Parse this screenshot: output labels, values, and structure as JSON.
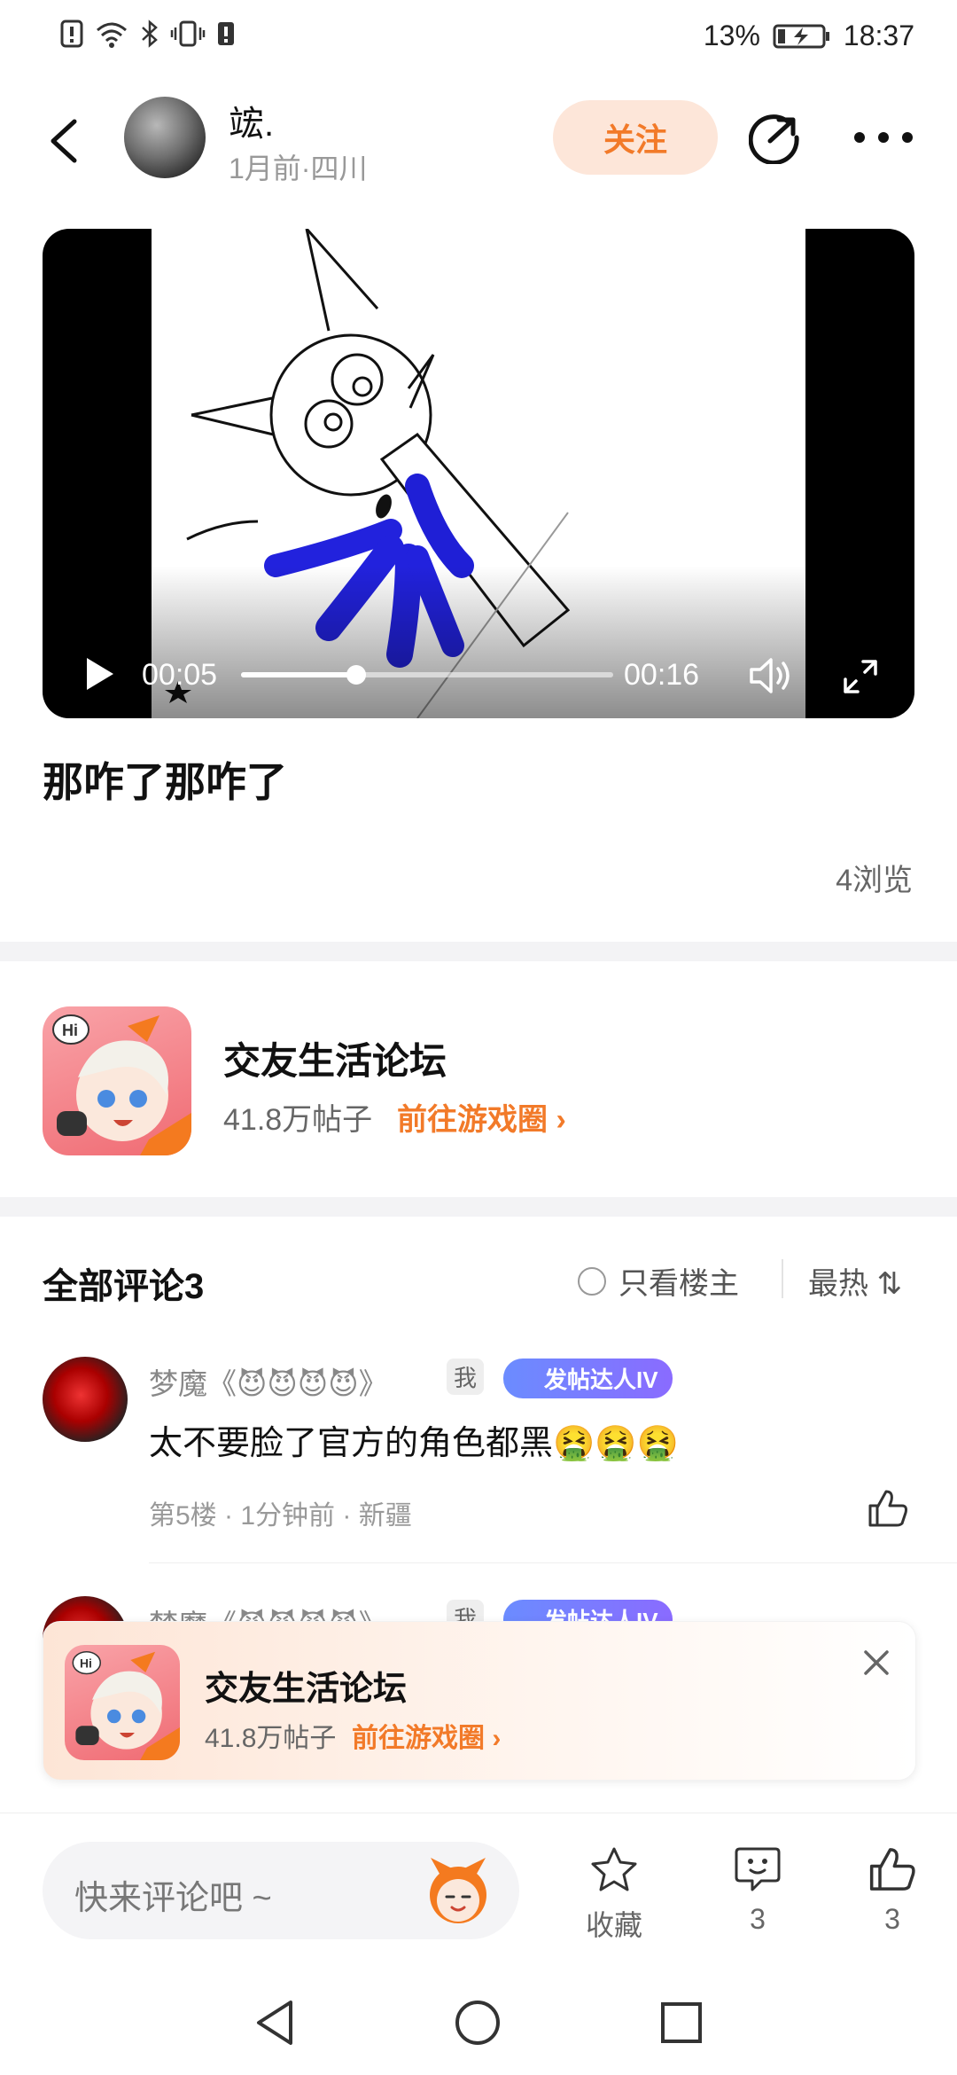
{
  "status_bar": {
    "battery": "13%",
    "time": "18:37"
  },
  "header": {
    "username": "竤.",
    "meta": "1月前·四川",
    "follow_label": "关注"
  },
  "video": {
    "current_time": "00:05",
    "duration": "00:16",
    "progress": 0.31
  },
  "post": {
    "title": "那咋了那咋了",
    "views": "4浏览"
  },
  "game_card": {
    "name": "交友生活论坛",
    "posts": "41.8万帖子",
    "link": "前往游戏圈 ›"
  },
  "comments": {
    "header": "全部评论3",
    "only_host": "只看楼主",
    "sort": "最热 ⇅",
    "items": [
      {
        "user": "梦魔《😈😈😈😈》",
        "tag_me": "我",
        "level": "发帖达人IV",
        "text": "太不要脸了官方的角色都黑🤮🤮🤮",
        "meta": "第5楼 · 1分钟前 · 新疆"
      },
      {
        "user": "梦魔《😈😈😈😈》",
        "tag_me": "我",
        "level": "发帖达人IV"
      }
    ]
  },
  "floating_card": {
    "name": "交友生活论坛",
    "posts": "41.8万帖子",
    "link": "前往游戏圈 ›"
  },
  "bottom_bar": {
    "input_placeholder": "快来评论吧 ~",
    "favorite_label": "收藏",
    "comment_count": "3",
    "like_count": "3"
  },
  "colors": {
    "accent": "#f27a29",
    "follow_bg": "#fde6d9",
    "level_badge": "#7a7cff"
  }
}
